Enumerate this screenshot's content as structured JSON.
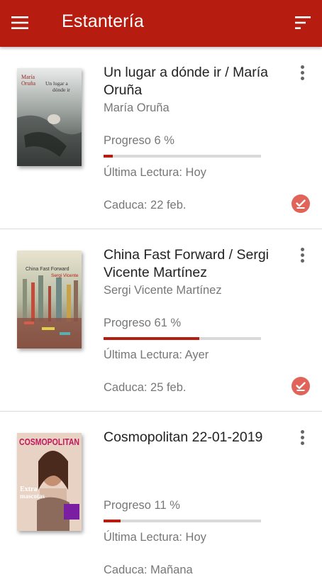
{
  "app": {
    "title": "Estantería",
    "bar_color": "#b71c10",
    "menu_icon": "hamburger-menu-icon",
    "sort_icon": "sort-icon"
  },
  "books": [
    {
      "title": "Un lugar a dónde ir  / María Oruña",
      "author": "María Oruña",
      "cover_text": [
        "María",
        "Oruña",
        "Un lugar a",
        "dónde ir"
      ],
      "progress_label": "Progreso 6 %",
      "progress": 0.06,
      "last_read": "Última Lectura: Hoy",
      "expires": "Caduca: 22 feb.",
      "downloaded": true
    },
    {
      "title": "China Fast Forward  / Sergi Vicente Martínez",
      "author": "Sergi Vicente Martínez",
      "cover_text": [
        "China Fast Forward",
        "Sergi Vicente"
      ],
      "progress_label": "Progreso 61 %",
      "progress": 0.61,
      "last_read": "Última Lectura: Ayer",
      "expires": "Caduca: 25 feb.",
      "downloaded": true
    },
    {
      "title": "Cosmopolitan 22-01-2019",
      "author": "",
      "cover_text": [
        "COSMOPOLITAN",
        "Extra",
        "mascotas"
      ],
      "progress_label": "Progreso 11 %",
      "progress": 0.11,
      "last_read": "Última Lectura: Hoy",
      "expires": "Caduca: Mañana",
      "downloaded": false
    }
  ]
}
